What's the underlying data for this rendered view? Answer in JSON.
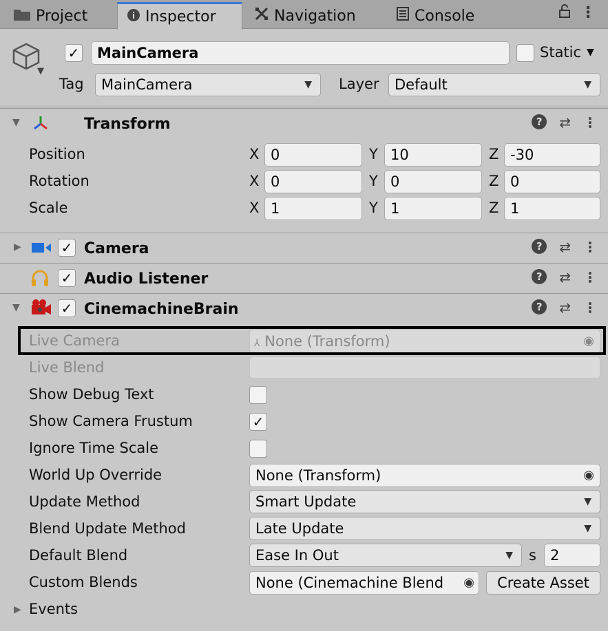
{
  "tabs": [
    {
      "label": "Project",
      "icon": "folder-icon"
    },
    {
      "label": "Inspector",
      "icon": "info-icon"
    },
    {
      "label": "Navigation",
      "icon": "navigation-icon"
    },
    {
      "label": "Console",
      "icon": "console-icon"
    }
  ],
  "header": {
    "object_name": "MainCamera",
    "static_label": "Static",
    "tag_label": "Tag",
    "tag_value": "MainCamera",
    "layer_label": "Layer",
    "layer_value": "Default"
  },
  "transform": {
    "title": "Transform",
    "rows": [
      {
        "label": "Position",
        "x": "0",
        "y": "10",
        "z": "-30"
      },
      {
        "label": "Rotation",
        "x": "0",
        "y": "0",
        "z": "0"
      },
      {
        "label": "Scale",
        "x": "1",
        "y": "1",
        "z": "1"
      }
    ],
    "axis_x": "X",
    "axis_y": "Y",
    "axis_z": "Z"
  },
  "camera": {
    "title": "Camera"
  },
  "audio": {
    "title": "Audio Listener"
  },
  "brain": {
    "title": "CinemachineBrain",
    "live_camera_label": "Live Camera",
    "live_camera_value": "None (Transform)",
    "live_blend_label": "Live Blend",
    "show_debug_label": "Show Debug Text",
    "show_frustum_label": "Show Camera Frustum",
    "ignore_time_label": "Ignore Time Scale",
    "world_up_label": "World Up Override",
    "world_up_value": "None (Transform)",
    "update_method_label": "Update Method",
    "update_method_value": "Smart Update",
    "blend_update_label": "Blend Update Method",
    "blend_update_value": "Late Update",
    "default_blend_label": "Default Blend",
    "default_blend_value": "Ease In Out",
    "default_blend_s_label": "s",
    "default_blend_s_value": "2",
    "custom_blends_label": "Custom Blends",
    "custom_blends_value": "None (Cinemachine Blend",
    "create_asset_label": "Create Asset",
    "events_label": "Events"
  },
  "show_debug_checked": false,
  "show_frustum_checked": true,
  "ignore_time_checked": false
}
